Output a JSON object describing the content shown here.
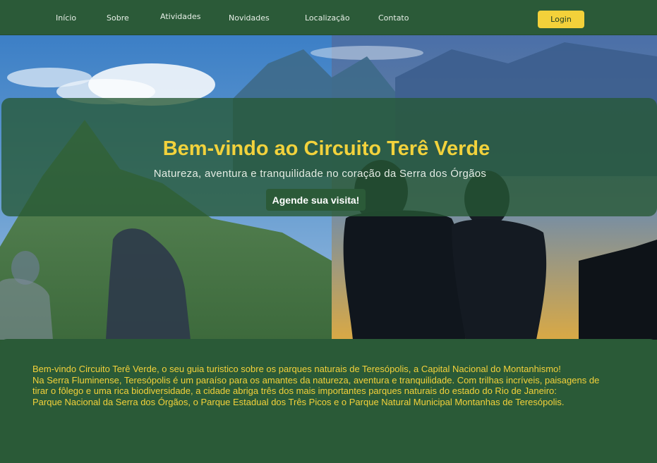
{
  "nav": {
    "items": [
      {
        "label": "Início"
      },
      {
        "label": "Sobre"
      },
      {
        "label": "Atividades"
      },
      {
        "label": "Novidades"
      },
      {
        "label": "Localização"
      },
      {
        "label": "Contato"
      }
    ],
    "login_label": "Login"
  },
  "hero": {
    "title": "Bem-vindo ao Circuito Terê Verde",
    "subtitle": "Natureza, aventura e tranquilidade no coração da Serra dos Órgãos",
    "cta_label": "Agende sua visita!"
  },
  "info": {
    "paragraphs": [
      "Bem-vindo Circuito Terê Verde, o seu guia turistico sobre os parques naturais de Teresópolis, a Capital Nacional do Montanhismo!",
      "Na Serra Fluminense, Teresópolis é um paraíso para os amantes da natureza, aventura e tranquilidade. Com trilhas incríveis, paisagens de tirar o fôlego e uma rica biodiversidade, a cidade abriga três dos mais importantes parques naturais do estado do Rio de Janeiro:",
      "Parque Nacional da Serra dos Órgãos, o Parque Estadual dos Três Picos e o Parque Natural Municipal Montanhas de Teresópolis."
    ]
  },
  "colors": {
    "brand_green": "#2b5a38",
    "accent_yellow": "#f3d13a"
  }
}
